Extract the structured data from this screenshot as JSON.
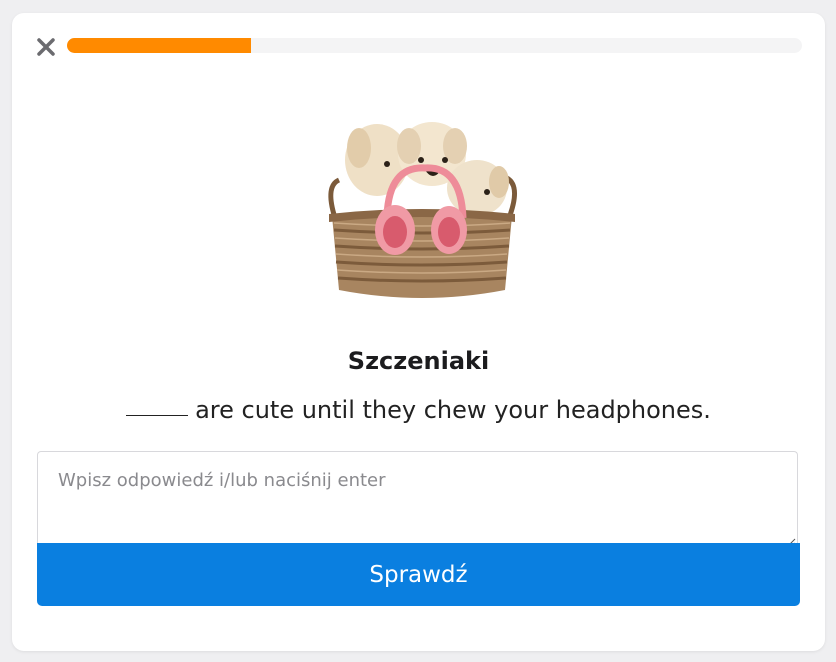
{
  "icons": {
    "close": "close-icon",
    "resize": "resize-grip-icon"
  },
  "colors": {
    "progress_fill": "#ff8a00",
    "progress_track": "#f4f4f5",
    "primary_button": "#0a7fe0",
    "background": "#efeff1"
  },
  "progress": {
    "fraction": 0.25
  },
  "exercise": {
    "image_alt": "",
    "title": "Szczeniaki",
    "sentence_rest": "are cute until they chew your headphones."
  },
  "answer": {
    "placeholder": "Wpisz odpowiedź i/lub naciśnij enter",
    "value": ""
  },
  "actions": {
    "check_label": "Sprawdź"
  }
}
